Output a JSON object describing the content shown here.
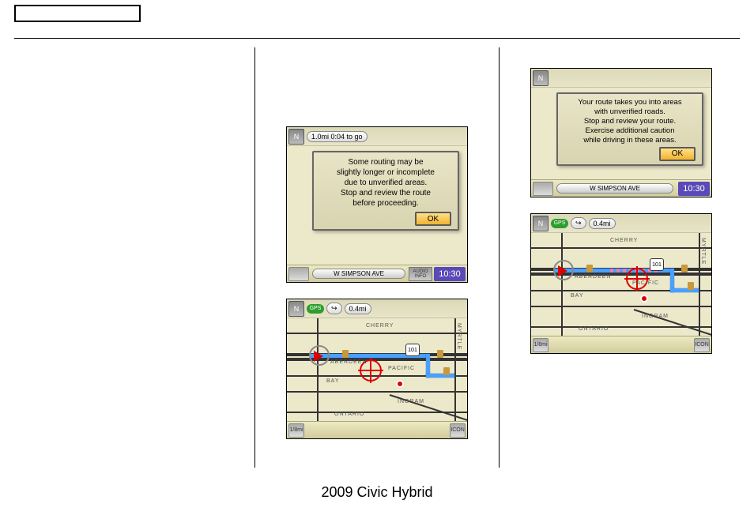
{
  "footer": "2009 Civic Hybrid",
  "screen_off": {
    "top_distance": "1.0mi 0:04 to go",
    "popup_l1": "Some routing may be",
    "popup_l2": "slightly longer or incomplete",
    "popup_l3": "due to unverified areas.",
    "popup_l4": "Stop and review the route",
    "popup_l5": "before proceeding.",
    "ok": "OK",
    "street": "W SIMPSON AVE",
    "audio": "AUDIO INFO",
    "clock": "10:30"
  },
  "map_off": {
    "dist": "0.4mi",
    "hwy": "101",
    "scale": "1/8mi",
    "icon_label": "ICON",
    "labels": {
      "cherry": "CHERRY",
      "pacific": "PACIFIC",
      "aberdeen": "ABERDEEN",
      "bay": "BAY",
      "ingram": "INGRAM",
      "ontario": "ONTARIO",
      "myrtle": "MYRTLE"
    }
  },
  "screen_on": {
    "popup_l1": "Your route takes you into areas",
    "popup_l2": "with unverified roads.",
    "popup_l3": "Stop and review your route.",
    "popup_l4": "Exercise additional caution",
    "popup_l5": "while driving in these areas.",
    "ok": "OK",
    "street": "W SIMPSON AVE",
    "clock": "10:30"
  },
  "map_on": {
    "dist": "0.4mi",
    "hwy": "101",
    "scale": "1/8mi",
    "icon_label": "ICON",
    "labels": {
      "cherry": "CHERRY",
      "pacific": "PACIFIC",
      "aberdeen": "ABERDEEN",
      "bay": "BAY",
      "ingram": "INGRAM",
      "ontario": "ONTARIO",
      "myrtle": "MYRTLE"
    }
  },
  "compass_label": "N"
}
